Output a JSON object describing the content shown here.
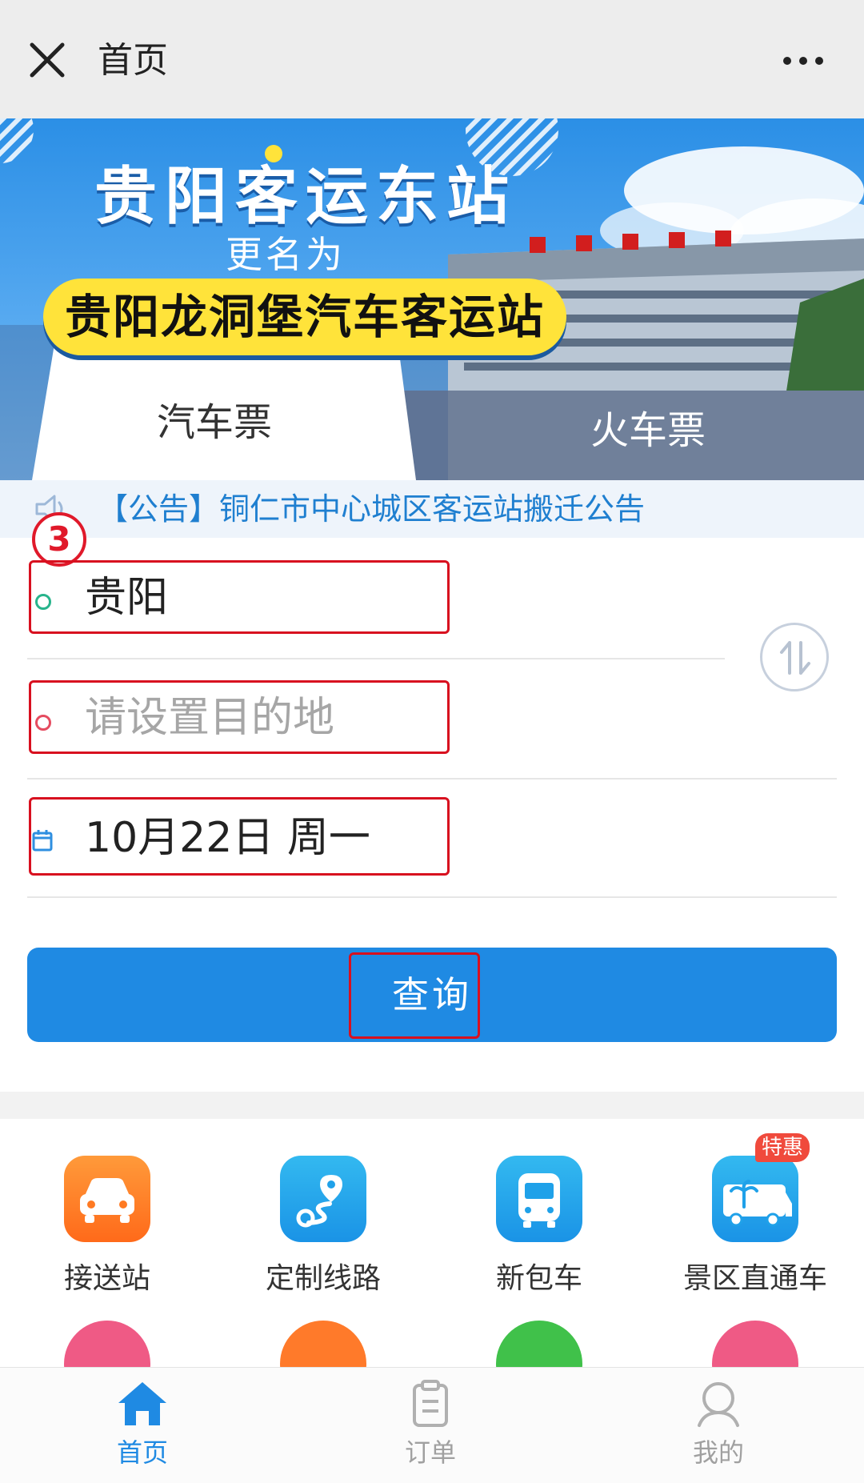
{
  "header": {
    "title": "首页",
    "close_icon": "close-icon",
    "more_icon": "more-icon"
  },
  "banner": {
    "title": "贵阳客运东站",
    "subtitle": "更名为",
    "highlight": "贵阳龙洞堡汽车客运站",
    "colors": {
      "sky": "#2b8fe6",
      "highlight": "#ffe33a"
    }
  },
  "ticket_tabs": [
    {
      "label": "汽车票",
      "selected": true
    },
    {
      "label": "火车票",
      "selected": false
    }
  ],
  "notice": {
    "icon": "speaker-icon",
    "text": "【公告】铜仁市中心城区客运站搬迁公告"
  },
  "form": {
    "step_badge": "3",
    "from_value": "贵阳",
    "to_placeholder": "请设置目的地",
    "date_value": "10月22日 周一",
    "swap_icon": "swap-icon",
    "query_label": "查询",
    "colors": {
      "accent": "#1f8ae3",
      "annotation": "#d8101f"
    }
  },
  "services": [
    {
      "label": "接送站",
      "icon": "car-icon"
    },
    {
      "label": "定制线路",
      "icon": "route-icon"
    },
    {
      "label": "新包车",
      "icon": "bus-icon"
    },
    {
      "label": "景区直通车",
      "icon": "scenic-bus-icon",
      "badge": "特惠"
    }
  ],
  "bottom_nav": [
    {
      "label": "首页",
      "icon": "home-icon",
      "active": true
    },
    {
      "label": "订单",
      "icon": "clipboard-icon",
      "active": false
    },
    {
      "label": "我的",
      "icon": "user-icon",
      "active": false
    }
  ]
}
